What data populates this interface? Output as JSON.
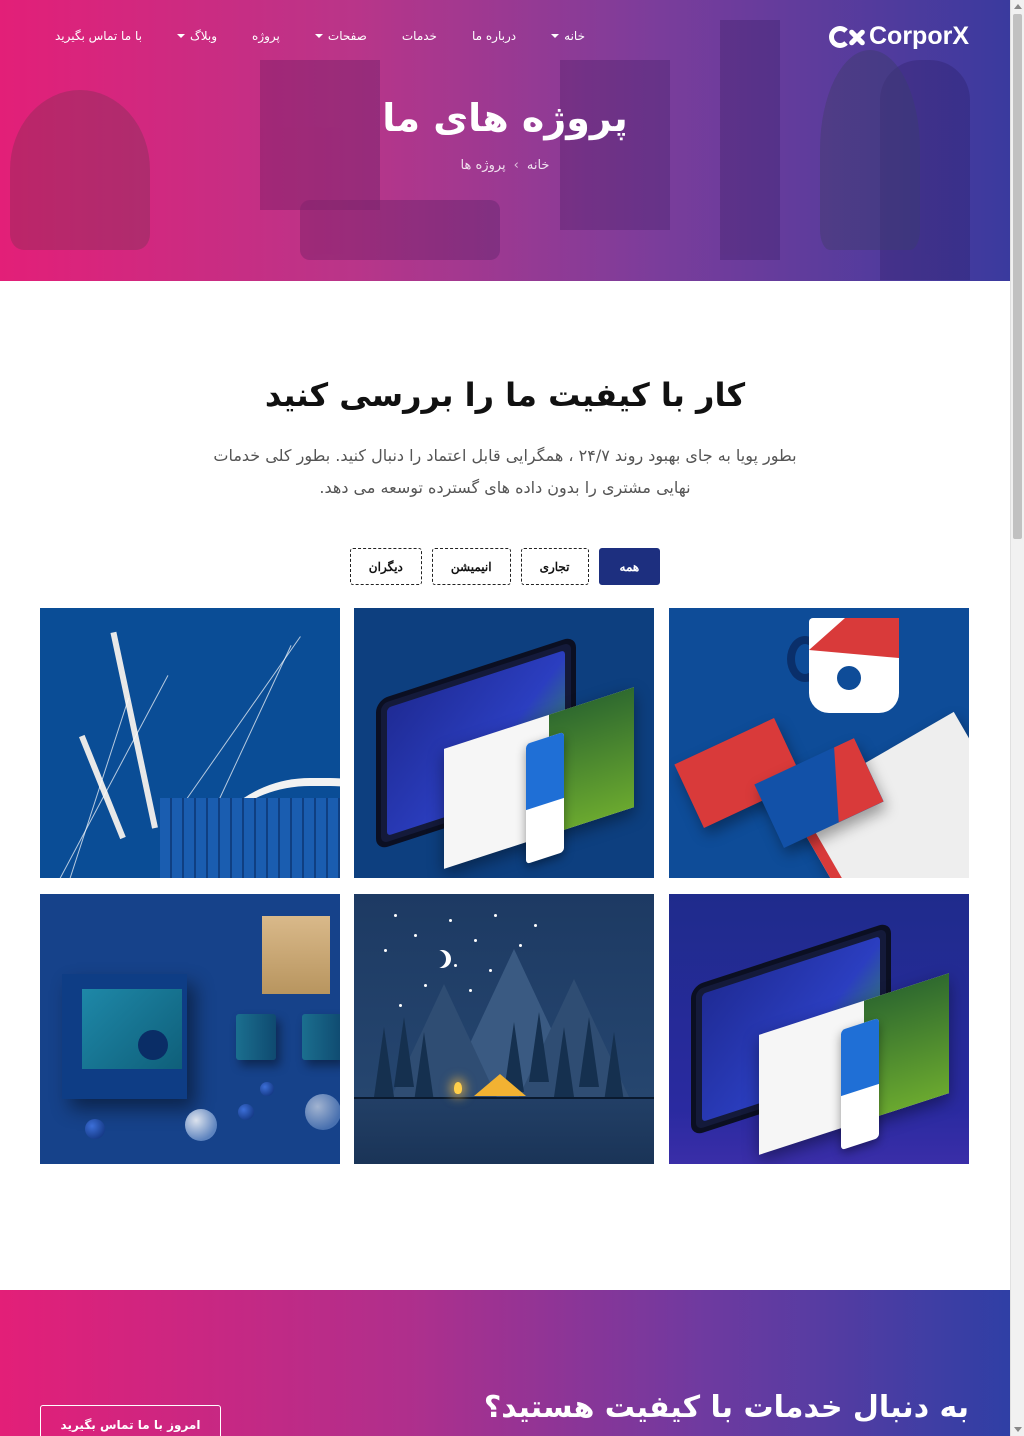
{
  "brand": {
    "name": "CorporX"
  },
  "nav": [
    {
      "label": "خانه",
      "dropdown": true
    },
    {
      "label": "درباره ما",
      "dropdown": false
    },
    {
      "label": "خدمات",
      "dropdown": false
    },
    {
      "label": "صفحات",
      "dropdown": true
    },
    {
      "label": "پروژه",
      "dropdown": false
    },
    {
      "label": "وبلاگ",
      "dropdown": true
    },
    {
      "label": "با ما تماس بگیرید",
      "dropdown": false
    }
  ],
  "hero": {
    "title": "پروژه های ما",
    "breadcrumb": {
      "home": "خانه",
      "separator": "›",
      "current": "پروژه ها"
    }
  },
  "section": {
    "title": "کار با کیفیت ما را بررسی کنید",
    "description": "بطور پویا به جای بهبود روند ۲۴/۷ ، همگرایی قابل اعتماد را دنبال کنید. بطور کلی خدمات نهایی مشتری را بدون داده های گسترده توسعه می دهد."
  },
  "filters": [
    {
      "label": "همه",
      "active": true
    },
    {
      "label": "تجاری",
      "active": false
    },
    {
      "label": "انیمیشن",
      "active": false
    },
    {
      "label": "دیگران",
      "active": false
    }
  ],
  "projects": [
    {
      "image": "brand-stationery-mockup"
    },
    {
      "image": "crypto-web-devices-mockup"
    },
    {
      "image": "stadium-architecture-photo"
    },
    {
      "image": "packaging-box-mockup"
    },
    {
      "image": "night-camping-illustration"
    },
    {
      "image": "crypto-web-devices-mockup"
    }
  ],
  "cta": {
    "title": "به دنبال خدمات با کیفیت هستید؟",
    "button": "امروز با ما تماس بگیرید"
  },
  "colors": {
    "accent": "#1d2f7f",
    "gradient_start": "#e31f78",
    "gradient_end": "#3a3a9e"
  }
}
